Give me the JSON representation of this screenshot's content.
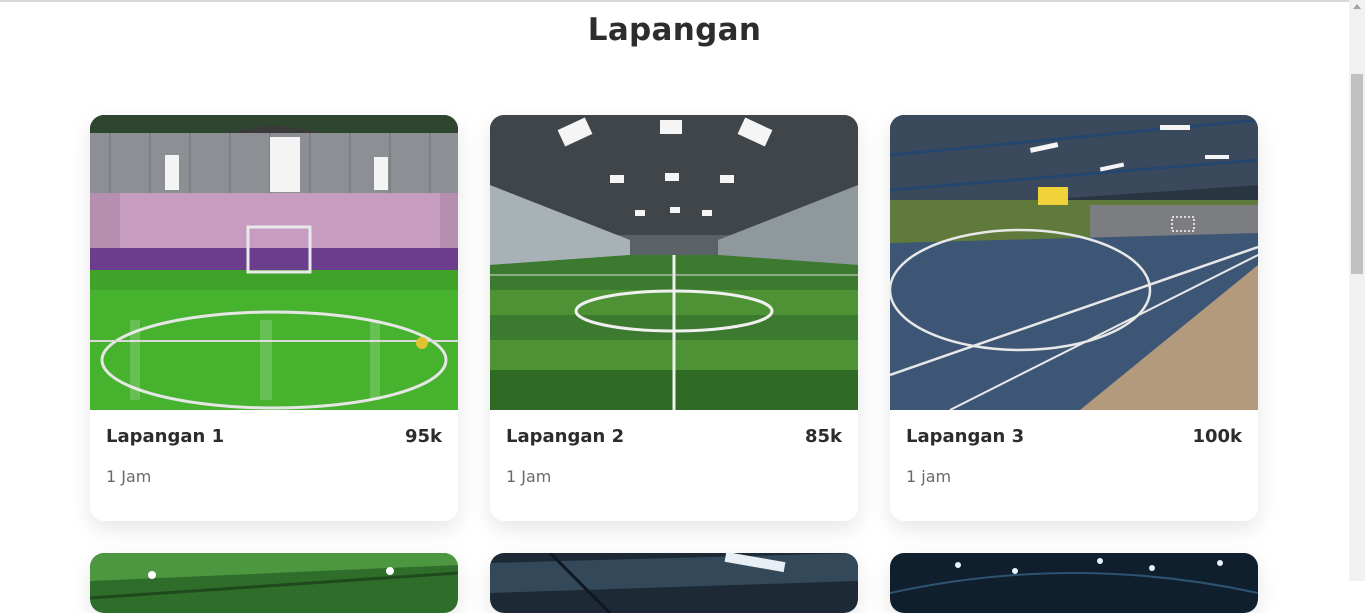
{
  "page": {
    "section_title": "Lapangan"
  },
  "cards": [
    {
      "name": "Lapangan 1",
      "price": "95k",
      "duration": "1 Jam",
      "image": "indoor-green-futsal-court-photo"
    },
    {
      "name": "Lapangan 2",
      "price": "85k",
      "duration": "1 Jam",
      "image": "artificial-grass-soccer-field-photo"
    },
    {
      "name": "Lapangan 3",
      "price": "100k",
      "duration": "1 jam",
      "image": "blue-futsal-court-photo"
    }
  ],
  "more_cards_images": [
    "green-roof-court-photo",
    "dark-hall-court-photo",
    "night-lit-court-photo"
  ],
  "colors": {
    "text": "#2b2b2b",
    "muted": "#6a6a6a",
    "background": "#ffffff"
  }
}
